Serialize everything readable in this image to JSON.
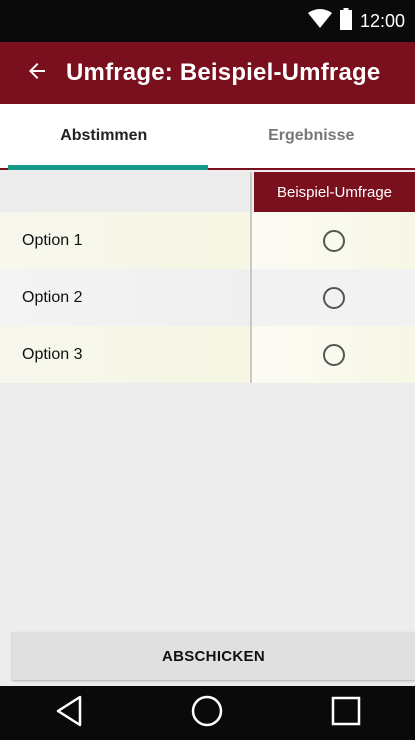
{
  "status_bar": {
    "time": "12:00",
    "icons": [
      "wifi-icon",
      "battery-icon"
    ]
  },
  "app_bar": {
    "title": "Umfrage: Beispiel-Umfrage",
    "back_icon": "arrow-left-icon"
  },
  "tabs": [
    {
      "label": "Abstimmen",
      "active": true
    },
    {
      "label": "Ergebnisse",
      "active": false
    }
  ],
  "poll": {
    "column_header": "Beispiel-Umfrage",
    "options": [
      {
        "label": "Option 1",
        "selected": false
      },
      {
        "label": "Option 2",
        "selected": false
      },
      {
        "label": "Option 3",
        "selected": false
      }
    ]
  },
  "submit_label": "ABSCHICKEN",
  "nav_bar": {
    "icons": [
      "back-triangle-icon",
      "home-circle-icon",
      "recents-square-icon"
    ]
  },
  "colors": {
    "primary": "#7a0f1d",
    "accent": "#13988a",
    "status_bar": "#0a0a0a"
  }
}
